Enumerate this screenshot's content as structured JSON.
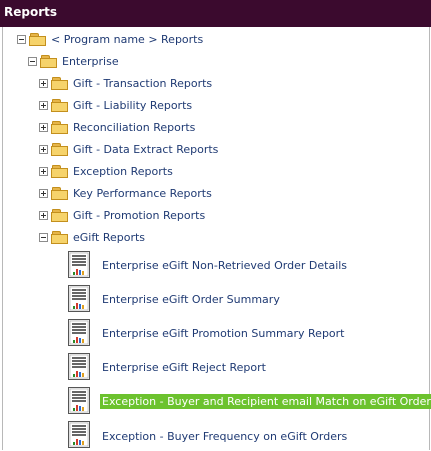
{
  "header": {
    "title": "Reports"
  },
  "tree": {
    "root": "< Program name > Reports",
    "enterprise": "Enterprise",
    "folders": [
      "Gift - Transaction Reports",
      "Gift - Liability Reports",
      "Reconciliation Reports",
      "Gift - Data Extract Reports",
      "Exception Reports",
      "Key Performance Reports",
      "Gift - Promotion Reports"
    ],
    "egift_folder": "eGift Reports",
    "egift_reports": [
      "Enterprise eGift Non-Retrieved Order Details",
      "Enterprise eGift Order Summary",
      "Enterprise eGift Promotion Summary Report",
      "Enterprise eGift Reject Report",
      "Exception - Buyer and Recipient email Match on eGift Orders",
      "Exception - Buyer Frequency on eGift Orders"
    ],
    "selected_report_index": 4
  },
  "colors": {
    "header_bg": "#3b0a2e",
    "link": "#1f3a73",
    "selected_bg": "#6cc22e"
  }
}
